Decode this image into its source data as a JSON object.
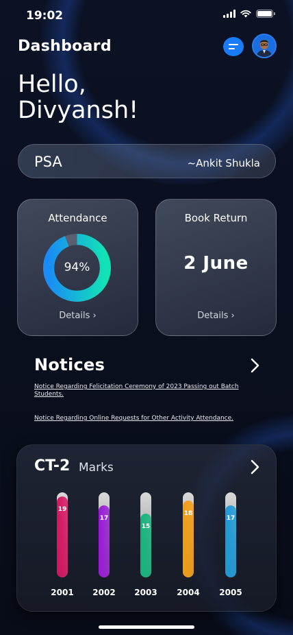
{
  "status_bar": {
    "time": "19:02"
  },
  "header": {
    "title": "Dashboard"
  },
  "greeting": {
    "line1": "Hello,",
    "line2": "Divyansh!"
  },
  "psa": {
    "label": "PSA",
    "mentor": "~Ankit Shukla"
  },
  "attendance": {
    "title": "Attendance",
    "percent_text": "94%",
    "percent": 94,
    "details": "Details"
  },
  "book_return": {
    "title": "Book Return",
    "date": "2 June",
    "details": "Details"
  },
  "notices": {
    "title": "Notices",
    "items": [
      "Notice Regarding Felicitation Ceremony of 2023 Passing out Batch Students.",
      "Notice Regarding Online Requests for Other Activity Attendance."
    ]
  },
  "ct": {
    "title": "CT-2",
    "subtitle": "Marks"
  },
  "colors": {
    "accent": "#1a7cf5",
    "donut_start": "#1a8cf5",
    "donut_end": "#12e3b5"
  },
  "chart_data": {
    "type": "bar",
    "categories": [
      "2001",
      "2002",
      "2003",
      "2004",
      "2005"
    ],
    "values": [
      19,
      17,
      15,
      18,
      17
    ],
    "value_labels": [
      "19",
      "17",
      "15",
      "18",
      "17"
    ],
    "ylim": [
      0,
      20
    ],
    "colors": [
      "#d4135f",
      "#9a1ad6",
      "#14b47c",
      "#f29d12",
      "#1a9ad6"
    ]
  }
}
